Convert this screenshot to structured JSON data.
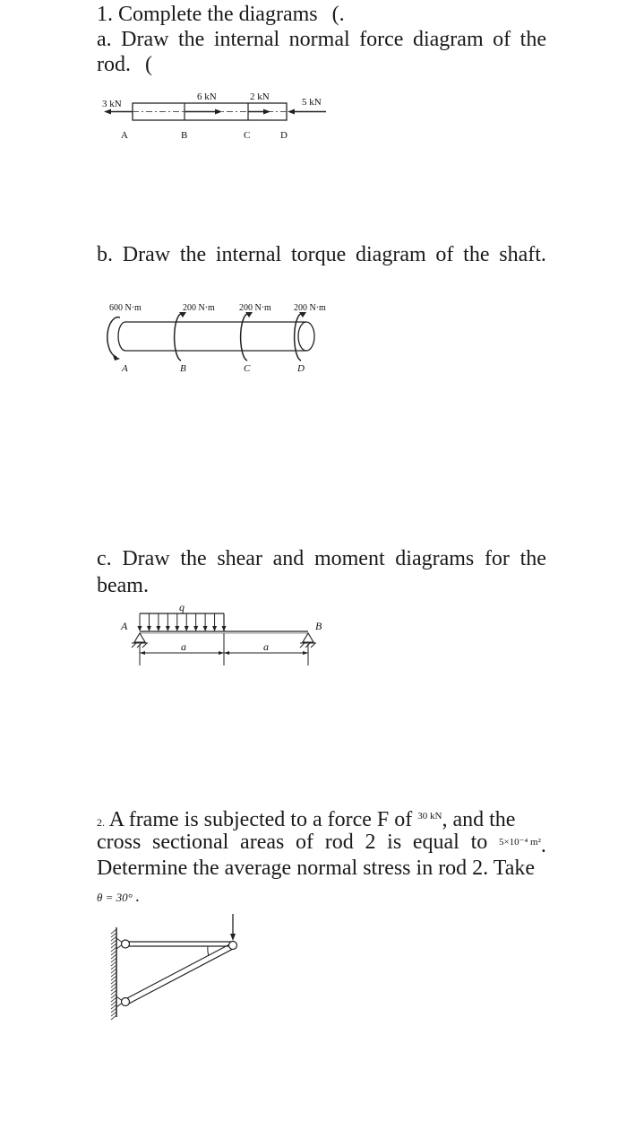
{
  "question1": {
    "heading": "1. Complete the diagrams",
    "heading_artifact": "(.",
    "part_a": {
      "line1": [
        "a.",
        "Draw",
        "the",
        "internal",
        "normal",
        "force",
        "diagram",
        "of",
        "the"
      ],
      "line2": "rod.",
      "line2_artifact": "(",
      "diagram": {
        "forces": {
          "left": "3 kN",
          "b": "6 kN",
          "c": "2 kN",
          "right": "5 kN"
        },
        "points": {
          "a": "A",
          "b": "B",
          "c": "C",
          "d": "D"
        }
      }
    },
    "part_b": {
      "line1": [
        "b.",
        "Draw",
        "the",
        "internal",
        "torque",
        "diagram",
        "of",
        "the",
        "shaft."
      ],
      "diagram": {
        "torques": {
          "a": "600 N·m",
          "b": "200 N·m",
          "c": "200 N·m",
          "d": "200 N·m"
        },
        "points": {
          "a": "A",
          "b": "B",
          "c": "C",
          "d": "D"
        }
      }
    },
    "part_c": {
      "line1": [
        "c.",
        "Draw",
        "the",
        "shear",
        "and",
        "moment",
        "diagrams",
        "for",
        "the"
      ],
      "line2": "beam.",
      "diagram": {
        "load_label": "q",
        "support_left": "A",
        "support_right": "B",
        "span_left": "a",
        "span_right": "a"
      }
    }
  },
  "question2": {
    "number": "2.",
    "line1_text": "A frame is subjected to a force F of",
    "force_value": "30 kN",
    "line1_end": ", and the",
    "line2_text": [
      "cross",
      "sectional",
      "areas",
      "of",
      "rod",
      "2",
      "is",
      "equal",
      "to"
    ],
    "area_value": "5×10⁻⁴ m²",
    "line2_end": ".",
    "line3": "Determine the average normal stress in rod 2. Take",
    "angle": "θ = 30°",
    "angle_end": "."
  }
}
